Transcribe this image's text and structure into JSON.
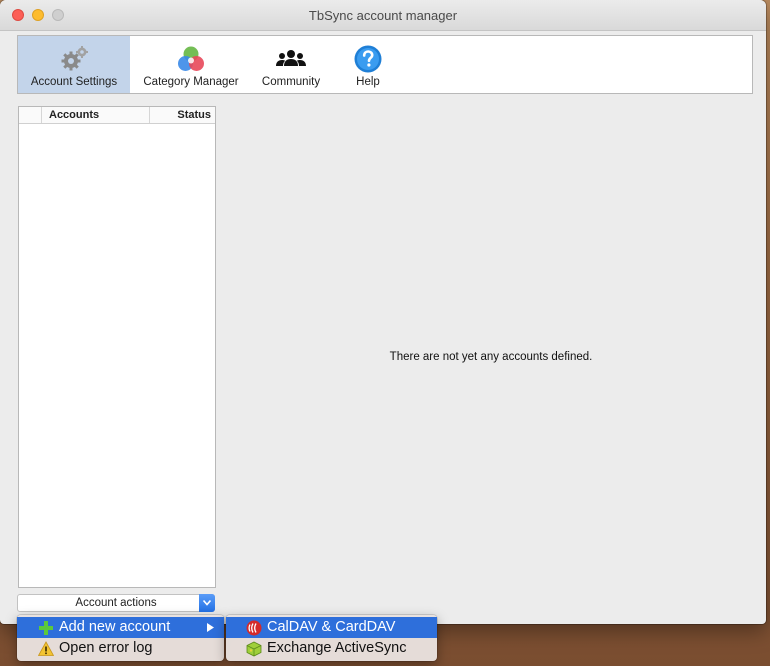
{
  "window": {
    "title": "TbSync account manager"
  },
  "toolbar": {
    "buttons": [
      {
        "label": "Account Settings",
        "icon": "gears-icon",
        "active": true
      },
      {
        "label": "Category Manager",
        "icon": "category-circles-icon",
        "active": false
      },
      {
        "label": "Community",
        "icon": "people-icon",
        "active": false
      },
      {
        "label": "Help",
        "icon": "help-icon",
        "active": false
      }
    ]
  },
  "accounts": {
    "columns": [
      "Accounts",
      "Status"
    ],
    "rows": [],
    "empty_message": "There are not yet any accounts defined."
  },
  "account_actions": {
    "label": "Account actions",
    "menu": [
      {
        "label": "Add new account",
        "icon": "plus-icon",
        "highlighted": true,
        "has_submenu": true
      },
      {
        "label": "Open error log",
        "icon": "warning-icon",
        "highlighted": false,
        "has_submenu": false
      }
    ],
    "submenu": [
      {
        "label": "CalDAV & CardDAV",
        "icon": "caldav-icon",
        "highlighted": true
      },
      {
        "label": "Exchange ActiveSync",
        "icon": "eas-icon",
        "highlighted": false
      }
    ]
  },
  "colors": {
    "accent": "#2e6fdb",
    "active_tab": "#c3d4ea"
  }
}
